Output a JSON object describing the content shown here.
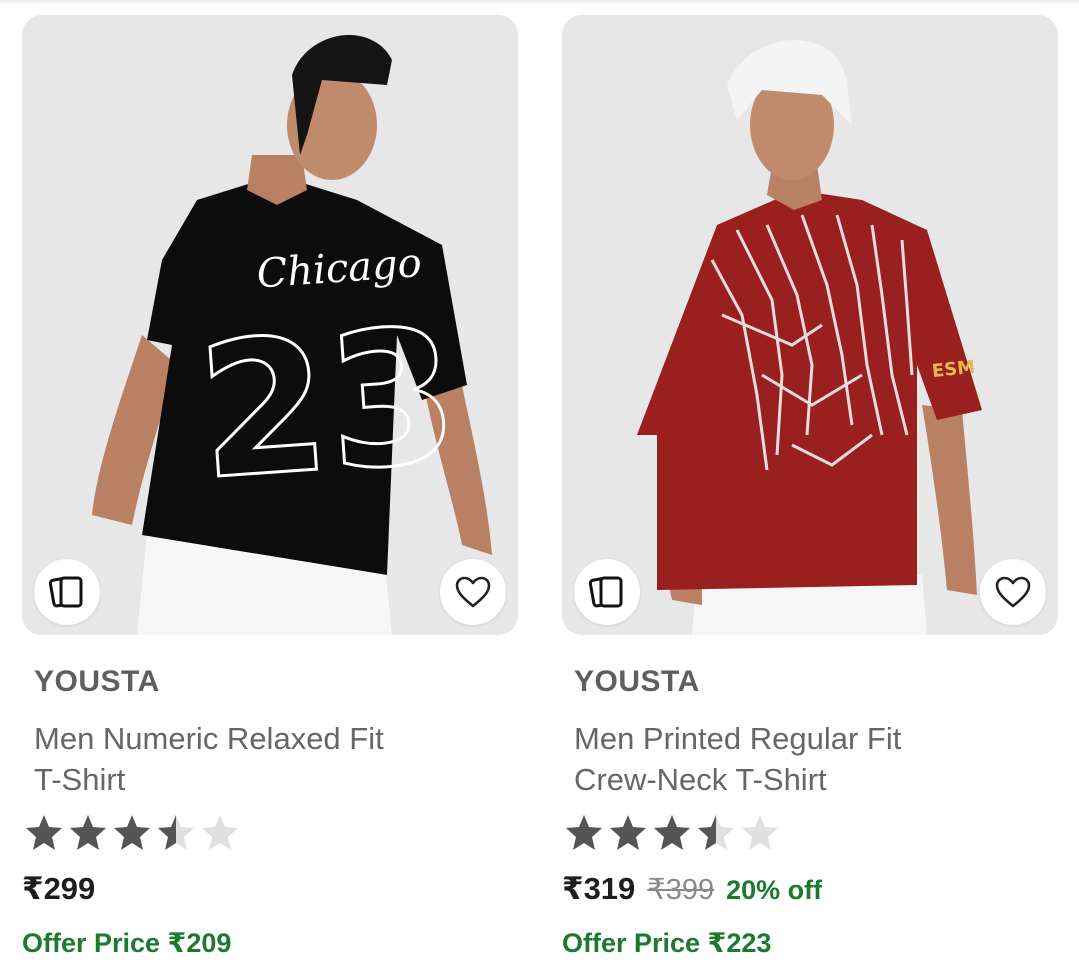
{
  "products": [
    {
      "brand": "YOUSTA",
      "title_line1": "Men Numeric Relaxed Fit",
      "title_line2": "T-Shirt",
      "rating": 3.5,
      "price": "₹299",
      "mrp": "",
      "discount": "",
      "offer": "Offer Price ₹209",
      "shirt_print_script": "Chicago",
      "shirt_print_number": "23",
      "shirt_color": "#0c0c0c",
      "cap_color": "#141414"
    },
    {
      "brand": "YOUSTA",
      "title_line1": "Men Printed Regular Fit",
      "title_line2": "Crew-Neck T-Shirt",
      "rating": 3.5,
      "price": "₹319",
      "mrp": "₹399",
      "discount": "20% off",
      "offer": "Offer Price ₹223",
      "shirt_print_sleeve": "ESM",
      "shirt_color": "#9a1f1f",
      "cap_color": "#f4f4f4"
    }
  ],
  "icons": {
    "similar": "similar-products-icon",
    "wishlist": "heart-outline-icon",
    "star": "star-icon"
  },
  "colors": {
    "offer_green": "#1b7a2f",
    "star_filled": "#555555",
    "star_empty": "#e0e0e0",
    "image_bg": "#e6e6e6"
  }
}
